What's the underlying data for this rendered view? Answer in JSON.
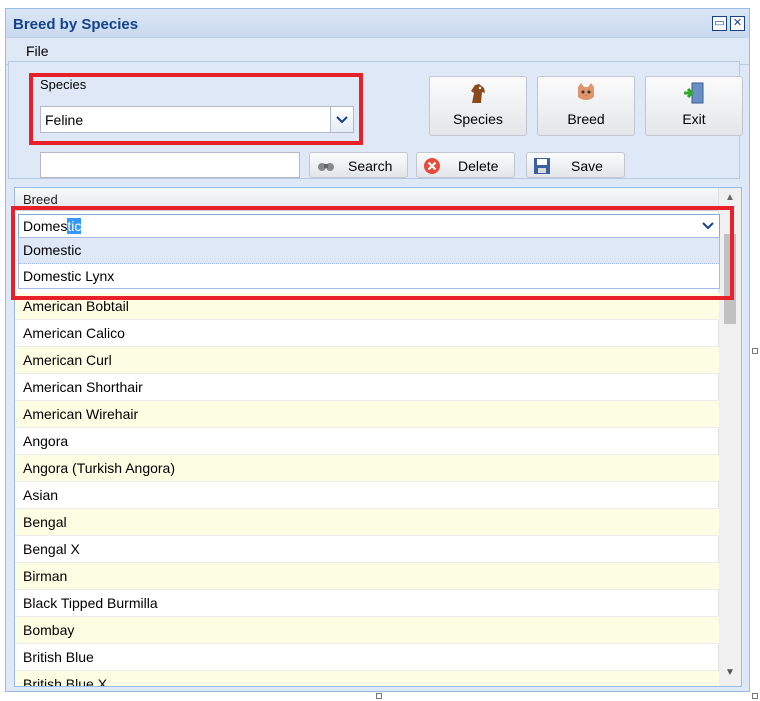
{
  "window": {
    "title": "Breed by Species"
  },
  "menu": {
    "file": "File"
  },
  "species": {
    "label": "Species",
    "value": "Feline"
  },
  "toolbar": {
    "species": "Species",
    "breed": "Breed",
    "exit": "Exit"
  },
  "search": {
    "value": "",
    "button": "Search"
  },
  "actions": {
    "delete": "Delete",
    "save": "Save"
  },
  "grid": {
    "header": "Breed",
    "editor": {
      "typed": "Domes",
      "selected": "tic"
    },
    "dropdown": [
      "Domestic",
      "Domestic Lynx"
    ],
    "rows": [
      "American Bobtail",
      "American Calico",
      "American Curl",
      "American Shorthair",
      "American Wirehair",
      "Angora",
      "Angora (Turkish Angora)",
      "Asian",
      "Bengal",
      "Bengal X",
      "Birman",
      "Black Tipped Burmilla",
      "Bombay",
      "British Blue",
      "British Blue X"
    ]
  },
  "colors": {
    "highlight": "#e8202a",
    "title": "#15428b",
    "alt_row": "#fdfde3"
  }
}
